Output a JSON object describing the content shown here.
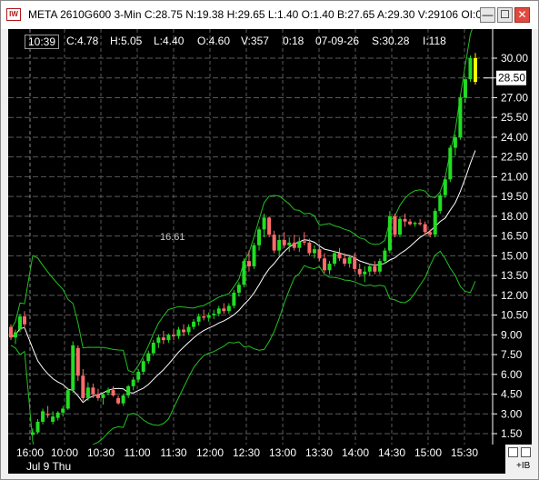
{
  "window": {
    "icon_text": "IW",
    "title": "META 2610G600 3-Min C:28.75 N:19.38 H:29.65 L:1.40 O:1.40 B:27.65 A:29.30 V:29106 OI:0",
    "minimize": "—",
    "maximize": "☐",
    "close": "✕"
  },
  "info": {
    "time": "10:39",
    "close": "C:4.78",
    "high": "H:5.05",
    "low": "L:4.40",
    "open": "O:4.60",
    "volume": "V:357",
    "change": "0:18",
    "date": "07-09-26",
    "strike": "S:30.28",
    "index": "I:118"
  },
  "annotation": "16.61",
  "price_tag": "28.50",
  "ib_label": "+IB",
  "colors": {
    "background": "#000000",
    "up": "#22dd22",
    "down": "#ff6b6b",
    "band": "#22c022",
    "ma": "#ffffff",
    "grid": "#5a5a5a",
    "highlight": "#ffff00"
  },
  "chart_data": {
    "type": "candlestick",
    "ylim": [
      0.4,
      31
    ],
    "y_ticks": [
      "30.00",
      "28.50",
      "27.00",
      "25.50",
      "24.00",
      "22.50",
      "21.00",
      "19.50",
      "18.00",
      "16.50",
      "15.00",
      "13.50",
      "12.00",
      "10.50",
      "9.00",
      "7.50",
      "6.00",
      "4.50",
      "3.00",
      "1.50"
    ],
    "y_tick_values": [
      30,
      28.5,
      27,
      25.5,
      24,
      22.5,
      21,
      19.5,
      18,
      16.5,
      15,
      13.5,
      12,
      10.5,
      9,
      7.5,
      6,
      4.5,
      3,
      1.5
    ],
    "x_ticks": [
      "16:00",
      "10:00",
      "10:30",
      "11:00",
      "11:30",
      "12:00",
      "12:30",
      "13:00",
      "13:30",
      "14:00",
      "14:30",
      "15:00",
      "15:30"
    ],
    "date_label": "Jul 9 Thu",
    "candles_ohlc": [
      [
        9.6,
        9.8,
        8.6,
        8.8
      ],
      [
        8.8,
        9.4,
        8.3,
        9.2
      ],
      [
        9.4,
        10.6,
        9.2,
        10.4
      ],
      [
        10.4,
        10.8,
        9.5,
        9.8
      ],
      [
        1.4,
        1.9,
        1.4,
        1.6
      ],
      [
        1.6,
        2.6,
        1.5,
        2.4
      ],
      [
        2.4,
        3.4,
        2.2,
        3.2
      ],
      [
        3.0,
        3.6,
        2.7,
        2.9
      ],
      [
        2.4,
        3.2,
        2.2,
        2.8
      ],
      [
        2.7,
        3.2,
        2.5,
        3.1
      ],
      [
        3.1,
        3.6,
        2.8,
        3.4
      ],
      [
        3.4,
        5.0,
        3.3,
        4.8
      ],
      [
        4.8,
        8.5,
        4.6,
        8.2
      ],
      [
        8.0,
        8.2,
        5.5,
        5.9
      ],
      [
        5.9,
        6.4,
        4.0,
        4.2
      ],
      [
        4.2,
        5.4,
        4.0,
        5.0
      ],
      [
        5.0,
        5.3,
        4.2,
        4.5
      ],
      [
        4.5,
        4.9,
        4.0,
        4.2
      ],
      [
        4.2,
        4.6,
        3.7,
        4.5
      ],
      [
        4.6,
        5.0,
        4.4,
        4.8
      ],
      [
        4.8,
        5.1,
        4.3,
        4.4
      ],
      [
        4.2,
        4.4,
        3.7,
        3.8
      ],
      [
        3.8,
        4.5,
        3.6,
        4.4
      ],
      [
        4.4,
        5.2,
        4.2,
        5.1
      ],
      [
        5.1,
        5.8,
        4.8,
        5.6
      ],
      [
        5.6,
        6.4,
        5.4,
        6.2
      ],
      [
        6.2,
        7.2,
        6.0,
        7.0
      ],
      [
        7.0,
        7.8,
        6.8,
        7.6
      ],
      [
        7.6,
        8.6,
        7.4,
        8.4
      ],
      [
        8.4,
        9.0,
        8.0,
        8.8
      ],
      [
        8.8,
        9.3,
        8.3,
        8.6
      ],
      [
        8.6,
        9.1,
        8.4,
        9.0
      ],
      [
        9.0,
        9.4,
        8.6,
        8.9
      ],
      [
        8.9,
        9.6,
        8.7,
        9.4
      ],
      [
        9.4,
        9.8,
        8.9,
        9.2
      ],
      [
        9.2,
        9.8,
        9.0,
        9.6
      ],
      [
        9.6,
        10.2,
        9.4,
        10.0
      ],
      [
        10.0,
        10.6,
        9.7,
        10.4
      ],
      [
        10.4,
        10.9,
        10.1,
        10.3
      ],
      [
        10.3,
        10.7,
        10.0,
        10.5
      ],
      [
        10.5,
        10.9,
        10.2,
        10.6
      ],
      [
        10.6,
        11.2,
        10.4,
        11.0
      ],
      [
        11.0,
        11.4,
        10.6,
        10.8
      ],
      [
        10.8,
        11.4,
        10.6,
        11.2
      ],
      [
        11.2,
        12.4,
        11.0,
        12.2
      ],
      [
        12.2,
        13.0,
        11.9,
        12.8
      ],
      [
        12.8,
        14.8,
        12.6,
        14.6
      ],
      [
        14.6,
        15.4,
        13.8,
        14.2
      ],
      [
        14.2,
        16.0,
        14.0,
        15.8
      ],
      [
        15.8,
        17.2,
        15.4,
        17.0
      ],
      [
        17.0,
        18.2,
        16.4,
        17.9
      ],
      [
        17.9,
        18.0,
        16.4,
        16.6
      ],
      [
        16.6,
        16.9,
        15.2,
        15.4
      ],
      [
        15.4,
        16.6,
        15.0,
        16.2
      ],
      [
        16.2,
        16.8,
        15.6,
        15.8
      ],
      [
        15.8,
        16.4,
        15.3,
        16.0
      ],
      [
        16.0,
        16.6,
        15.4,
        15.6
      ],
      [
        15.6,
        16.4,
        15.3,
        16.1
      ],
      [
        16.1,
        16.8,
        15.8,
        16.0
      ],
      [
        16.0,
        16.3,
        15.0,
        15.2
      ],
      [
        15.2,
        15.8,
        14.8,
        15.5
      ],
      [
        15.5,
        15.9,
        14.6,
        14.8
      ],
      [
        14.8,
        15.2,
        13.7,
        13.9
      ],
      [
        13.9,
        14.6,
        13.6,
        14.4
      ],
      [
        14.4,
        15.4,
        14.2,
        15.2
      ],
      [
        15.2,
        15.6,
        14.6,
        14.8
      ],
      [
        14.8,
        15.2,
        14.2,
        14.4
      ],
      [
        14.4,
        15.0,
        14.1,
        14.9
      ],
      [
        14.9,
        15.2,
        13.8,
        14.0
      ],
      [
        14.0,
        14.4,
        13.4,
        13.6
      ],
      [
        13.6,
        14.2,
        13.0,
        13.8
      ],
      [
        13.8,
        14.4,
        13.5,
        14.2
      ],
      [
        14.2,
        14.6,
        13.6,
        13.8
      ],
      [
        13.8,
        14.8,
        13.6,
        14.6
      ],
      [
        14.6,
        15.6,
        14.4,
        15.4
      ],
      [
        15.4,
        18.4,
        15.2,
        18.0
      ],
      [
        18.0,
        18.2,
        16.4,
        16.6
      ],
      [
        16.6,
        18.0,
        16.4,
        17.8
      ],
      [
        17.8,
        18.2,
        17.2,
        17.6
      ],
      [
        17.6,
        17.8,
        17.3,
        17.4
      ],
      [
        17.4,
        17.6,
        17.2,
        17.5
      ],
      [
        17.5,
        17.8,
        17.3,
        17.4
      ],
      [
        17.4,
        17.6,
        16.6,
        16.8
      ],
      [
        16.8,
        17.0,
        16.4,
        16.6
      ],
      [
        16.6,
        18.6,
        16.4,
        18.4
      ],
      [
        18.4,
        19.8,
        18.2,
        19.6
      ],
      [
        19.6,
        21.0,
        19.4,
        20.8
      ],
      [
        20.8,
        23.4,
        20.6,
        23.2
      ],
      [
        23.2,
        24.2,
        22.6,
        24.0
      ],
      [
        24.0,
        27.2,
        23.8,
        27.0
      ],
      [
        27.0,
        28.6,
        26.6,
        28.4
      ],
      [
        28.4,
        30.2,
        28.2,
        30.0
      ],
      [
        30.0,
        30.4,
        28.0,
        28.2
      ]
    ]
  }
}
